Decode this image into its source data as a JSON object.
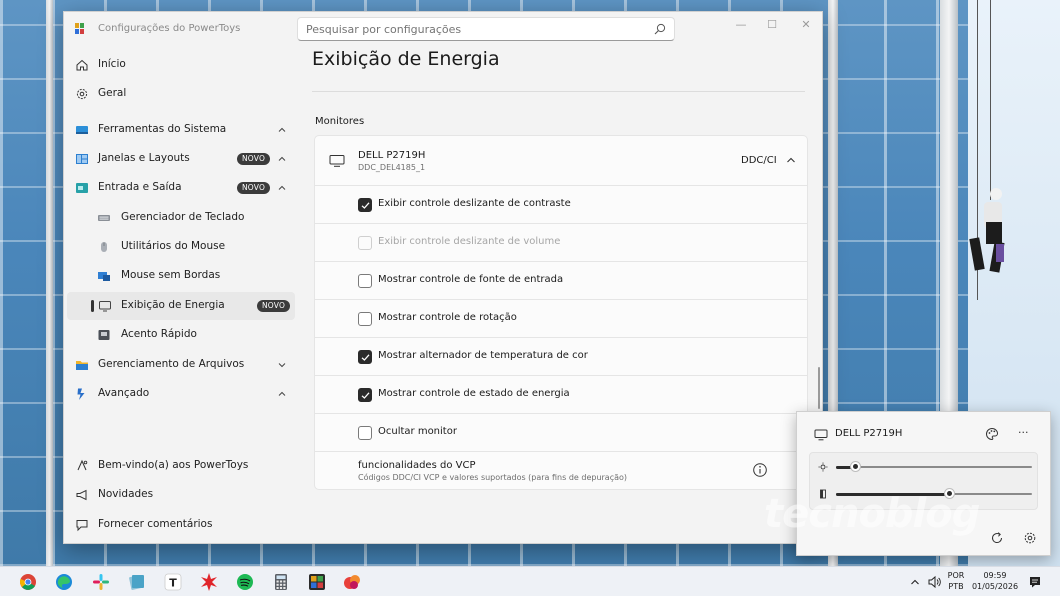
{
  "window": {
    "title": "Configurações do PowerToys",
    "search_placeholder": "Pesquisar por configurações",
    "controls": [
      "—",
      "☐",
      "✕"
    ]
  },
  "sidebar": {
    "items": [
      {
        "label": "Início",
        "icon": "home-icon"
      },
      {
        "label": "Geral",
        "icon": "gear-icon"
      },
      {
        "label": "Ferramentas do Sistema",
        "icon": "system-tools-icon",
        "chevron": "up"
      },
      {
        "label": "Janelas e Layouts",
        "icon": "windows-layouts-icon",
        "badge": "NOVO",
        "chevron": "up"
      },
      {
        "label": "Entrada e Saída",
        "icon": "input-output-icon",
        "badge": "NOVO",
        "chevron": "up"
      },
      {
        "label": "Gerenciador de Teclado",
        "icon": "keyboard-icon"
      },
      {
        "label": "Utilitários do Mouse",
        "icon": "mouse-icon"
      },
      {
        "label": "Mouse sem Bordas",
        "icon": "mouse-without-borders-icon"
      },
      {
        "label": "Exibição de Energia",
        "icon": "monitor-icon",
        "badge": "NOVO",
        "selected": true
      },
      {
        "label": "Acento Rápido",
        "icon": "quick-accent-icon"
      },
      {
        "label": "Gerenciamento de Arquivos",
        "icon": "folder-icon",
        "chevron": "down"
      },
      {
        "label": "Avançado",
        "icon": "advanced-icon",
        "chevron": "up"
      }
    ],
    "footer": [
      {
        "label": "Bem-vindo(a) aos PowerToys",
        "icon": "welcome-icon"
      },
      {
        "label": "Novidades",
        "icon": "megaphone-icon"
      },
      {
        "label": "Fornecer comentários",
        "icon": "feedback-icon"
      }
    ]
  },
  "content": {
    "page_title": "Exibição de Energia",
    "section_label": "Monitores",
    "monitor": {
      "name": "DELL P2719H",
      "id": "DDC_DEL4185_1",
      "protocol": "DDC/CI"
    },
    "options": [
      {
        "label": "Exibir controle deslizante de contraste",
        "checked": true,
        "disabled": false
      },
      {
        "label": "Exibir controle deslizante de volume",
        "checked": false,
        "disabled": true
      },
      {
        "label": "Mostrar controle de fonte de entrada",
        "checked": false,
        "disabled": false
      },
      {
        "label": "Mostrar controle de rotação",
        "checked": false,
        "disabled": false
      },
      {
        "label": "Mostrar alternador de temperatura de cor",
        "checked": true,
        "disabled": false
      },
      {
        "label": "Mostrar controle de estado de energia",
        "checked": true,
        "disabled": false
      },
      {
        "label": "Ocultar monitor",
        "checked": false,
        "disabled": false
      }
    ],
    "vcp": {
      "title": "funcionalidades do VCP",
      "subtitle": "Códigos DDC/CI VCP e valores suportados (para fins de depuração)"
    }
  },
  "flyout": {
    "monitor_name": "DELL P2719H",
    "more": "···",
    "brightness_fraction": 0.1,
    "contrast_fraction": 0.58
  },
  "watermark": "tecnoblog",
  "taskbar": {
    "lang_top": "POR",
    "lang_bottom": "PTB",
    "time": "09:59",
    "date": "01/05/2026"
  },
  "colors": {
    "accent": "#2b2b2b",
    "badge_bg": "#3b3b3b"
  }
}
